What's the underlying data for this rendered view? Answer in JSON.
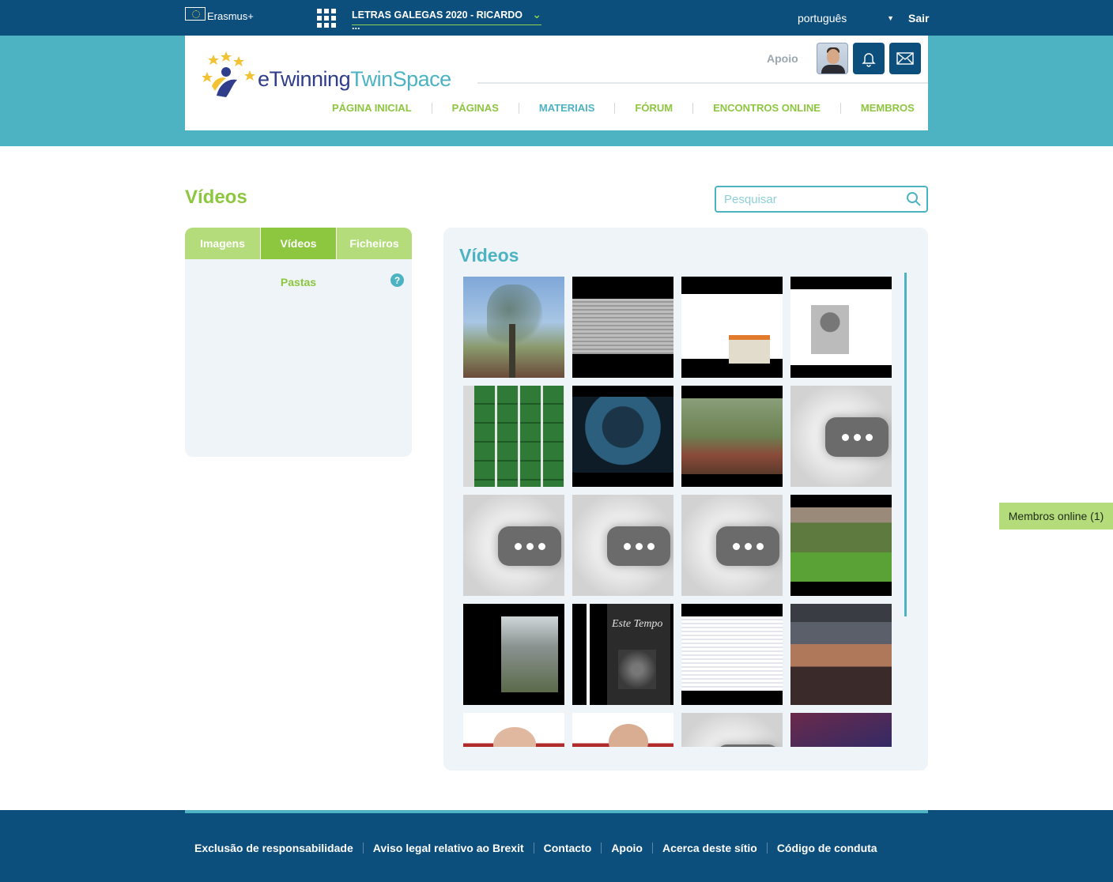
{
  "topbar": {
    "program": "Erasmus+",
    "space_title": "LETRAS GALEGAS 2020 - RICARDO ...",
    "language": "português",
    "logout": "Sair"
  },
  "header": {
    "logo_part1": "eTwinning",
    "logo_part2": "TwinSpace",
    "help": "Apoio",
    "nav": [
      {
        "label": "PÁGINA INICIAL"
      },
      {
        "label": "PÁGINAS"
      },
      {
        "label": "MATERIAIS"
      },
      {
        "label": "FÓRUM"
      },
      {
        "label": "ENCONTROS ONLINE"
      },
      {
        "label": "MEMBROS"
      }
    ],
    "active_nav": "MATERIAIS"
  },
  "page": {
    "title": "Vídeos",
    "search_placeholder": "Pesquisar"
  },
  "side_panel": {
    "tabs": [
      {
        "label": "Imagens"
      },
      {
        "label": "Vídeos"
      },
      {
        "label": "Ficheiros"
      }
    ],
    "active_tab": "Vídeos",
    "folders_label": "Pastas",
    "help_glyph": "?"
  },
  "video_panel": {
    "title": "Vídeos",
    "thumbnails": [
      {
        "style": "tree"
      },
      {
        "style": "book"
      },
      {
        "style": "chart"
      },
      {
        "style": "slide"
      },
      {
        "style": "lockers"
      },
      {
        "style": "indo"
      },
      {
        "style": "olive"
      },
      {
        "style": "placeholder"
      },
      {
        "style": "placeholder"
      },
      {
        "style": "placeholder"
      },
      {
        "style": "placeholder"
      },
      {
        "style": "hedge"
      },
      {
        "style": "winter"
      },
      {
        "style": "estetempo"
      },
      {
        "style": "sheet"
      },
      {
        "style": "class"
      },
      {
        "style": "bald"
      },
      {
        "style": "bald2"
      },
      {
        "style": "placeholder"
      },
      {
        "style": "purple"
      }
    ]
  },
  "members_online": "Membros online (1)",
  "footer": {
    "links": [
      {
        "label": "Exclusão de responsabilidade"
      },
      {
        "label": "Aviso legal relativo ao Brexit"
      },
      {
        "label": "Contacto"
      },
      {
        "label": "Apoio"
      },
      {
        "label": "Acerca deste sítio"
      },
      {
        "label": "Código de conduta"
      }
    ]
  },
  "colors": {
    "navy": "#0d4f7c",
    "teal": "#4db3c2",
    "green": "#8dc63f",
    "light_green": "#b5dc7b",
    "panel_bg": "#eef4f7"
  }
}
